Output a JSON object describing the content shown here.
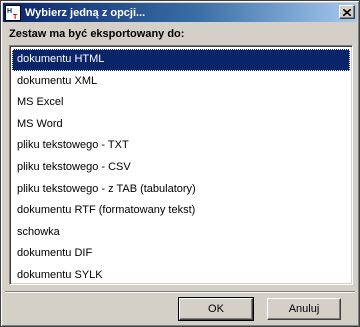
{
  "window": {
    "title": "Wybierz jedną z opcji...",
    "icon": "ht-app-icon"
  },
  "prompt": "Zestaw ma być eksportowany do:",
  "list": {
    "selected_index": 0,
    "items": [
      {
        "label": "dokumentu HTML"
      },
      {
        "label": "dokumentu XML"
      },
      {
        "label": "MS Excel"
      },
      {
        "label": "MS Word"
      },
      {
        "label": "pliku tekstowego - TXT"
      },
      {
        "label": "pliku tekstowego - CSV"
      },
      {
        "label": "pliku tekstowego - z TAB (tabulatory)"
      },
      {
        "label": "dokumentu RTF (formatowany tekst)"
      },
      {
        "label": "schowka"
      },
      {
        "label": "dokumentu DIF"
      },
      {
        "label": "dokumentu SYLK"
      }
    ]
  },
  "buttons": {
    "ok_label": "OK",
    "cancel_label": "Anuluj"
  },
  "colors": {
    "selection": "#0a246a",
    "face": "#d4d0c8",
    "titlebar_start": "#0a246a",
    "titlebar_end": "#a6caf0"
  }
}
